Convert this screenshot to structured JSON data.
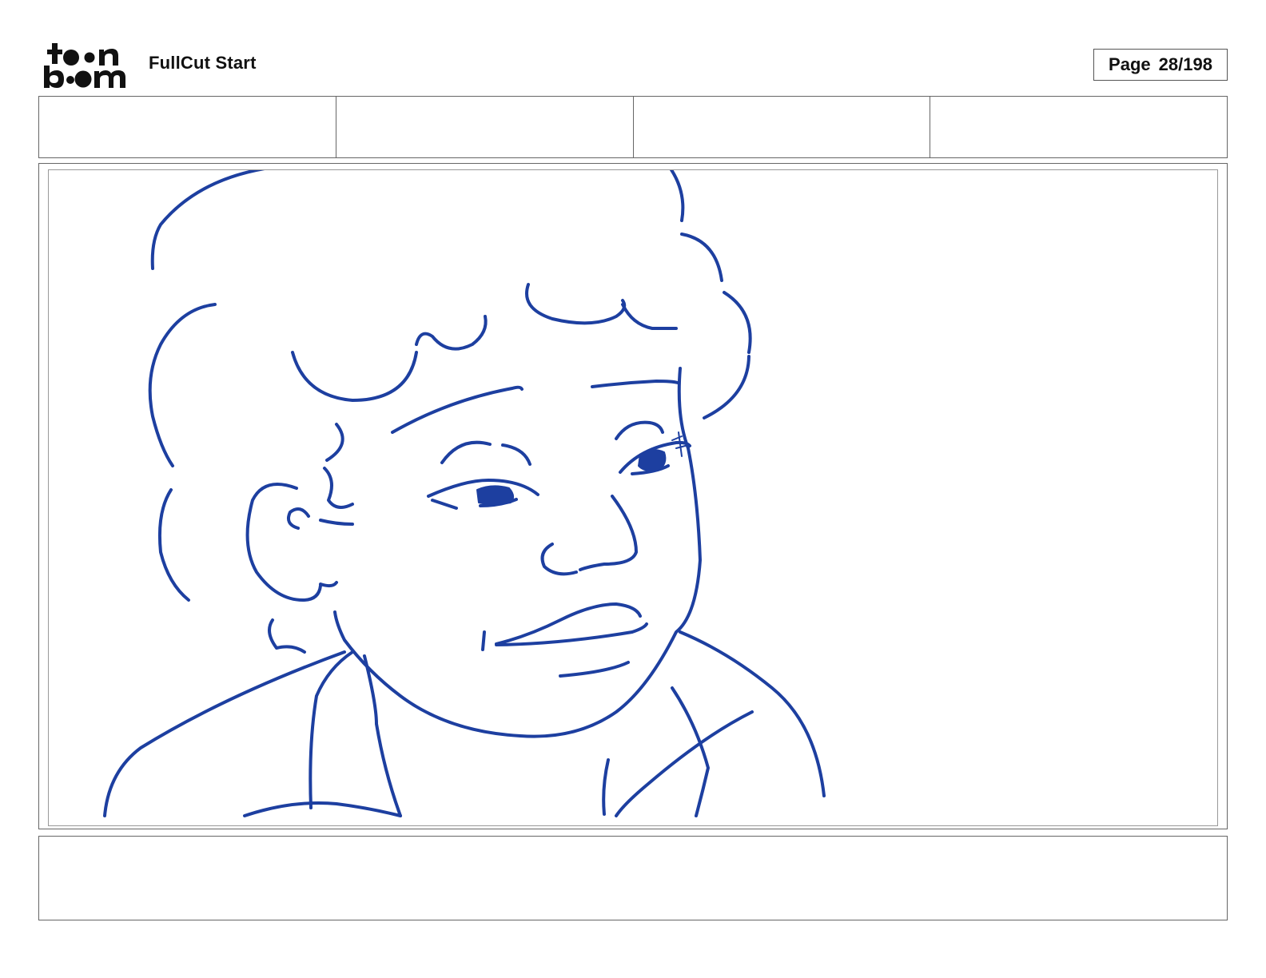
{
  "header": {
    "logo_text": [
      "toon",
      "boom"
    ],
    "title": "FullCut Start",
    "page_label": "Page",
    "page_value": "28/198"
  },
  "fields": [
    "",
    "",
    "",
    ""
  ],
  "panel": {
    "sketch_color": "#1d3fa0"
  },
  "notes": ""
}
